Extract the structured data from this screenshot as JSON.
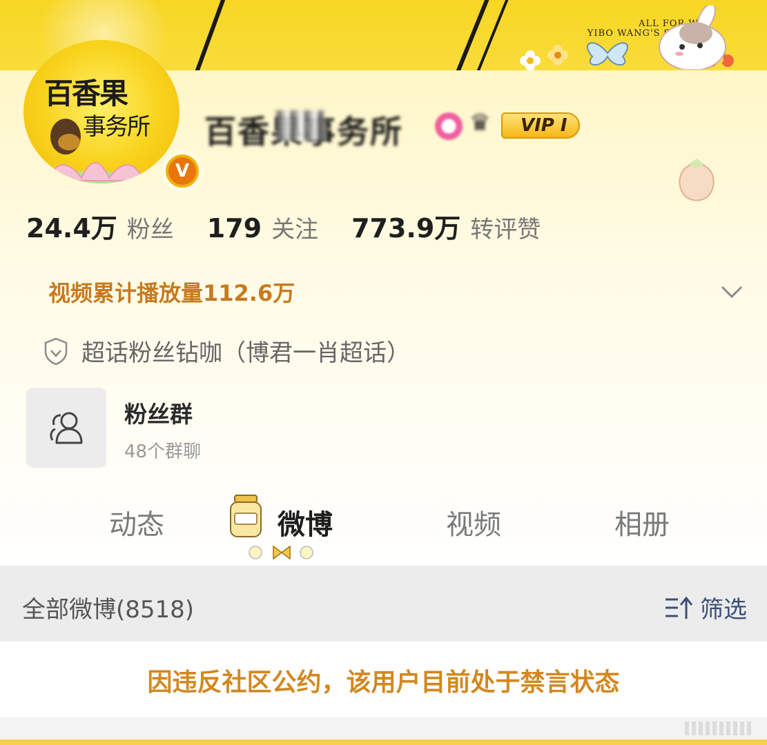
{
  "banner": {
    "text_line1": "ALL FOR WB",
    "text_line2": "YIBO WANG'S STUDIO"
  },
  "profile": {
    "avatar_brand": "百香果",
    "avatar_sub": "事务所",
    "verified_badge": "V",
    "username": "百香果事务所",
    "vip_label": "VIP I"
  },
  "stats": {
    "followers_num": "24.4万",
    "followers_label": "粉丝",
    "following_num": "179",
    "following_label": "关注",
    "interactions_num": "773.9万",
    "interactions_label": "转评赞"
  },
  "video_views": "视频累计播放量112.6万",
  "supertopic": "超话粉丝钻咖（博君一肖超话）",
  "fan_group": {
    "title": "粉丝群",
    "subtitle": "48个群聊"
  },
  "tabs": [
    {
      "label": "动态"
    },
    {
      "label": "微博"
    },
    {
      "label": "视频"
    },
    {
      "label": "相册"
    }
  ],
  "filter": {
    "all_label": "全部微博(8518)",
    "filter_label": "筛选"
  },
  "notice": "因违反社区公约，该用户目前处于禁言状态",
  "colors": {
    "banner_yellow": "#f7d623",
    "accent_orange": "#c87a1e",
    "notice_orange": "#d2881f",
    "filter_blue": "#3a4f78"
  }
}
